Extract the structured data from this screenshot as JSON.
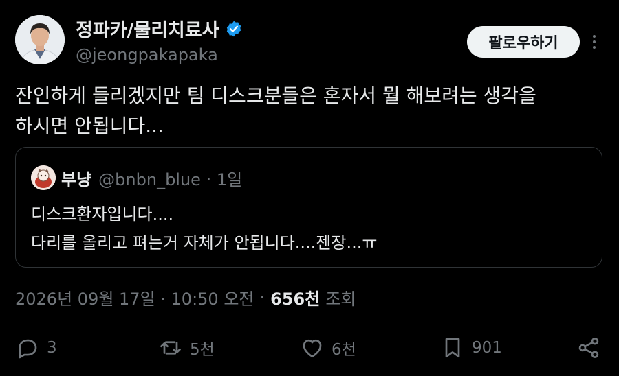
{
  "author": {
    "display_name": "정파카/물리치료사",
    "handle": "@jeongpakapaka",
    "verified_icon": "verified-badge-icon"
  },
  "follow_button": "팔로우하기",
  "tweet_lines": [
    "잔인하게 들리겠지만 팀 디스크분들은 혼자서 뭘 해보려는 생각을",
    "하시면 안됩니다..."
  ],
  "quote": {
    "display_name": "부냥",
    "handle": "@bnbn_blue · 1일",
    "lines": [
      "디스크환자입니다....",
      "다리를 올리고 펴는거 자체가 안됩니다....젠장...ㅠ"
    ]
  },
  "meta": {
    "timestamp": "2026년 09월 17일 · 10:50 오전",
    "separator": "·",
    "views_count": "656천",
    "views_label": "조회"
  },
  "actions": {
    "replies": "3",
    "retweets": "5천",
    "likes": "6천",
    "bookmarks": "901"
  },
  "colors": {
    "background": "#000000",
    "text": "#e7e9ea",
    "secondary": "#71767b",
    "verified": "#1d9bf0",
    "border": "#2f3336"
  }
}
